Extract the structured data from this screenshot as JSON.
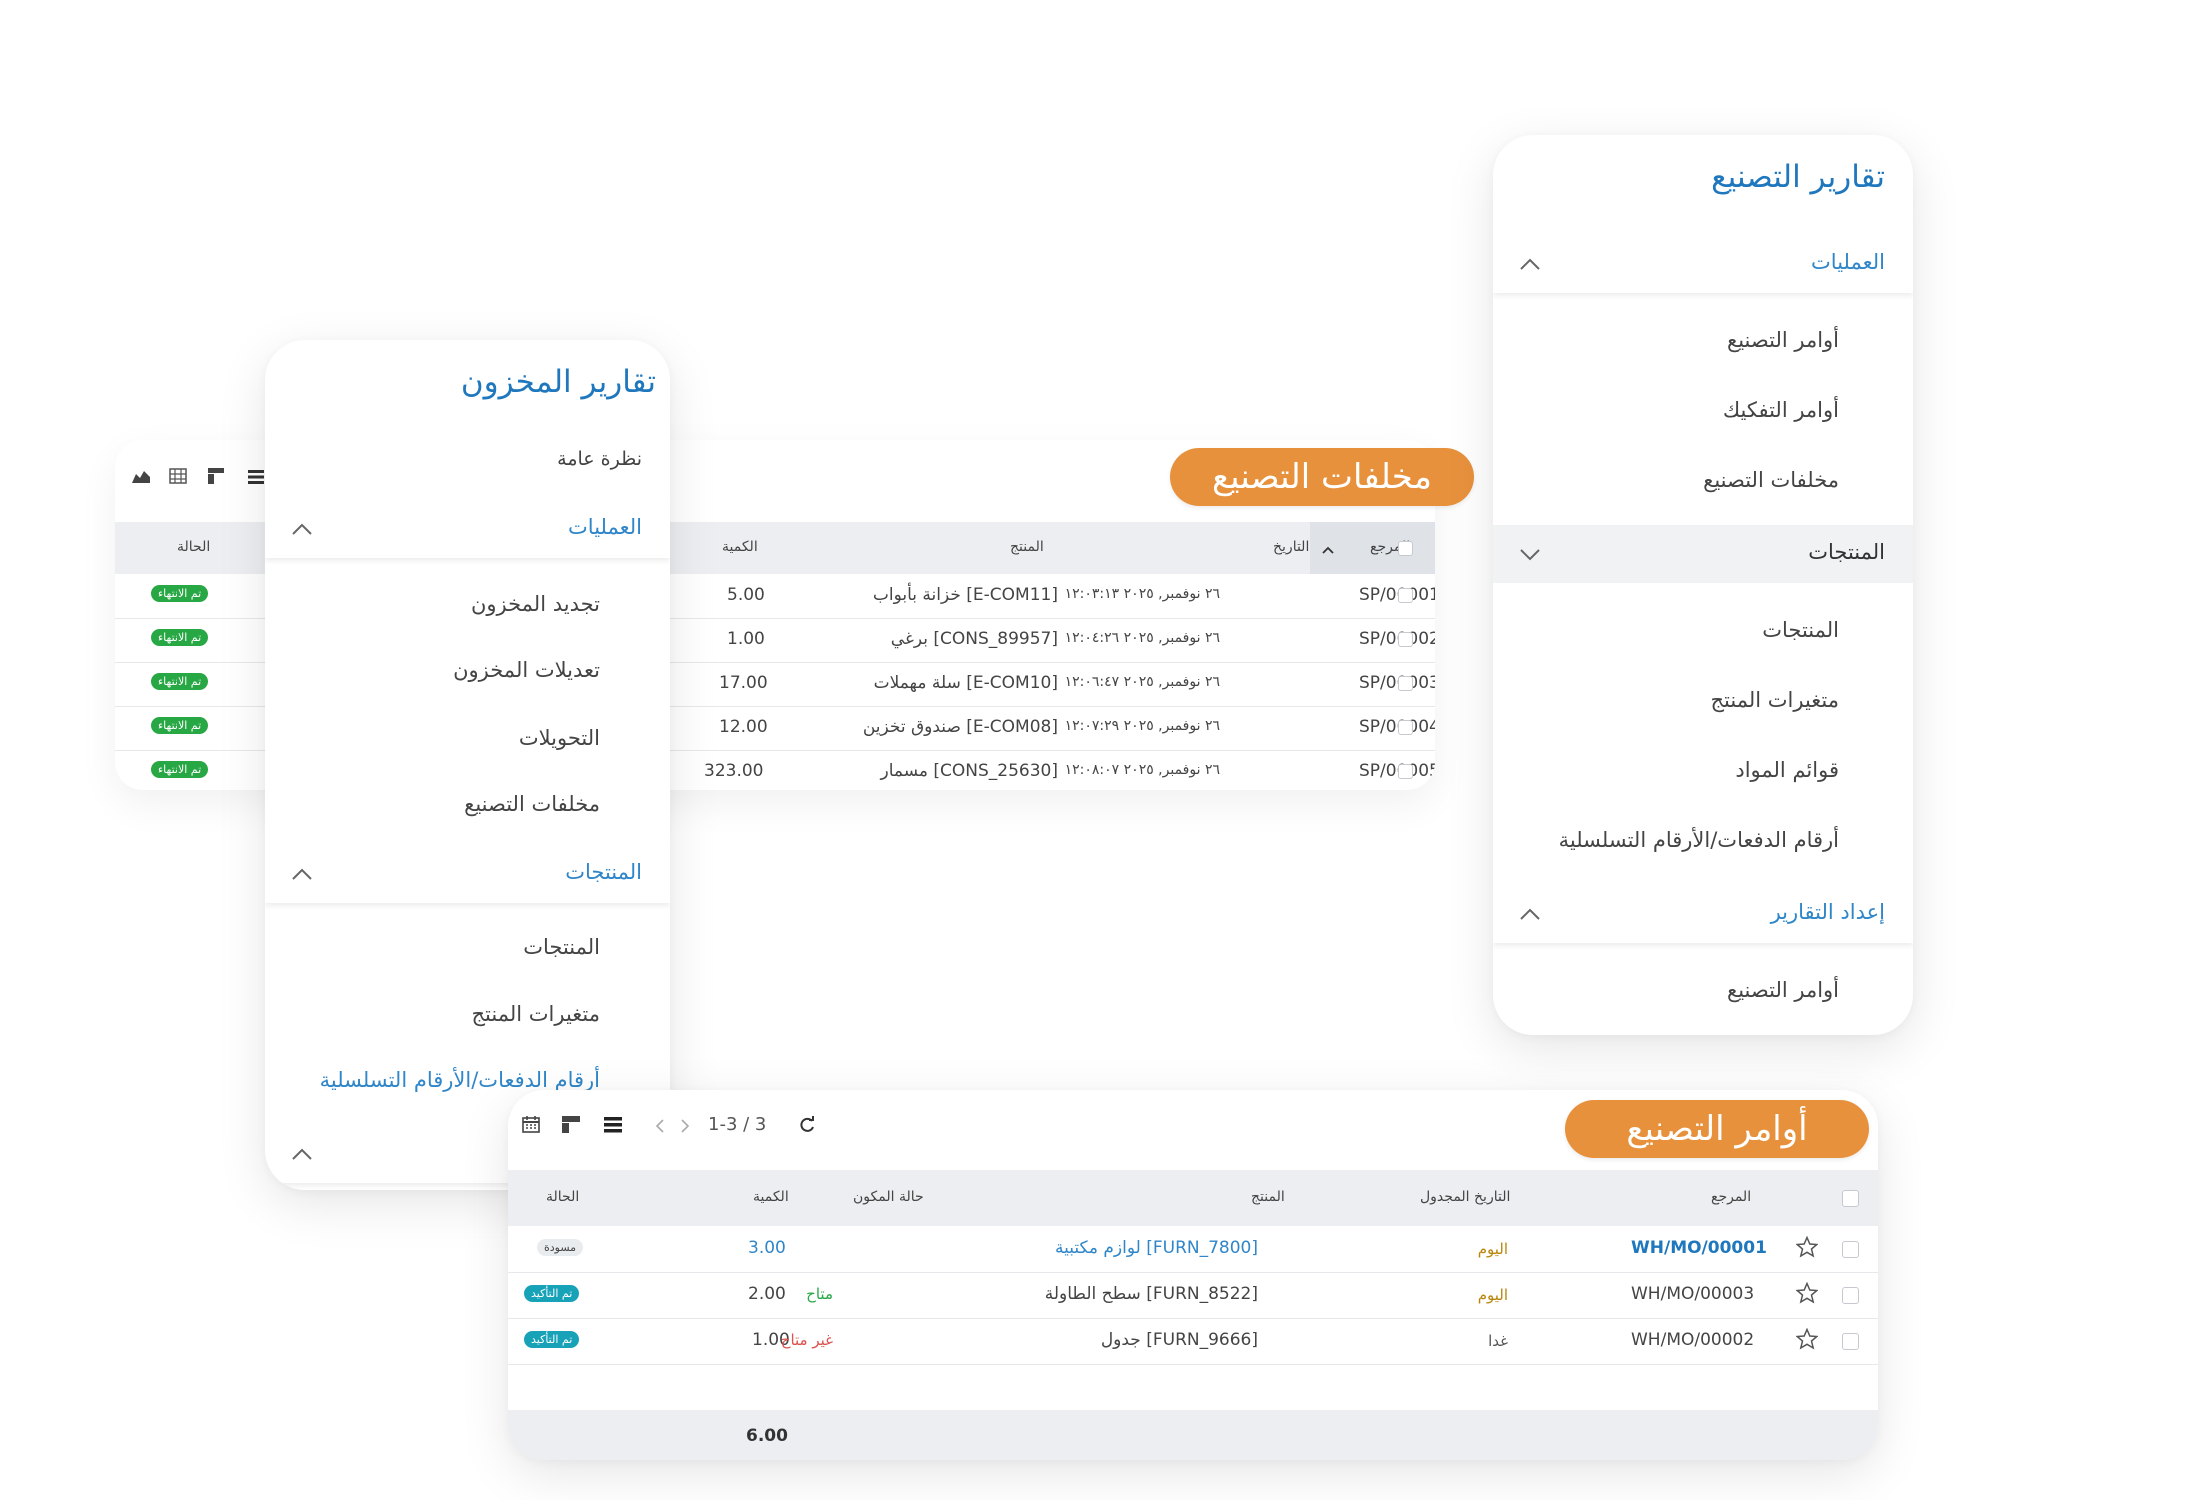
{
  "manufacturing_menu": {
    "title": "تقارير التصنيع",
    "sections": [
      {
        "label": "العمليات",
        "expanded": true,
        "items": [
          "أوامر التصنيع",
          "أوامر التفكيك",
          "مخلفات التصنيع"
        ]
      },
      {
        "label": "المنتجات",
        "expanded": false,
        "items": [
          "المنتجات",
          "متغيرات المنتج",
          "قوائم المواد",
          "أرقام الدفعات/الأرقام التسلسلية"
        ]
      },
      {
        "label": "إعداد التقارير",
        "expanded": true,
        "items": [
          "أوامر التصنيع"
        ]
      }
    ]
  },
  "inventory_menu": {
    "title": "تقارير المخزون",
    "overview": "نظرة عامة",
    "sections": [
      {
        "label": "العمليات",
        "items": [
          "تجديد المخزون",
          "تعديلات المخزون",
          "التحويلات",
          "مخلفات التصنيع"
        ]
      },
      {
        "label": "المنتجات",
        "items": [
          "المنتجات",
          "متغيرات المنتج",
          "أرقام الدفعات/الأرقام التسلسلية"
        ]
      }
    ]
  },
  "scrap": {
    "tag": "مخلفات التصنيع",
    "columns": {
      "status": "الحالة",
      "qty": "الكمية",
      "product": "المنتج",
      "date": "التاريخ",
      "ref": "المرجع"
    },
    "rows": [
      {
        "ref": "SP/00001",
        "date": "٢٦ نوفمبر, ٢٠٢٥ ١٢:٠٣:١٣",
        "product": "[E-COM11] خزانة بأبواب",
        "qty": "5.00",
        "status": "تم الانتهاء"
      },
      {
        "ref": "SP/00002",
        "date": "٢٦ نوفمبر, ٢٠٢٥ ١٢:٠٤:٢٦",
        "product": "[CONS_89957] برغي",
        "qty": "1.00",
        "status": "تم الانتهاء"
      },
      {
        "ref": "SP/00003",
        "date": "٢٦ نوفمبر, ٢٠٢٥ ١٢:٠٦:٤٧",
        "product": "[E-COM10] سلة مهملات",
        "qty": "17.00",
        "status": "تم الانتهاء"
      },
      {
        "ref": "SP/00004",
        "date": "٢٦ نوفمبر, ٢٠٢٥ ١٢:٠٧:٢٩",
        "product": "[E-COM08] صندوق تخزين",
        "qty": "12.00",
        "status": "تم الانتهاء"
      },
      {
        "ref": "SP/00005",
        "date": "٢٦ نوفمبر, ٢٠٢٥ ١٢:٠٨:٠٧",
        "product": "[CONS_25630] مسمار",
        "qty": "323.00",
        "status": "تم الانتهاء"
      }
    ]
  },
  "mo": {
    "tag": "أوامر التصنيع",
    "pager": "1-3 / 3",
    "columns": {
      "ref": "المرجع",
      "scheduled": "التاريخ المجدول",
      "product": "المنتج",
      "component": "حالة المكون",
      "qty": "الكمية",
      "status": "الحالة"
    },
    "rows": [
      {
        "ref": "WH/MO/00001",
        "scheduled": "اليوم",
        "product": "[FURN_7800] لوازم مكتبية",
        "component": "",
        "qty": "3.00",
        "status": "مسودة"
      },
      {
        "ref": "WH/MO/00003",
        "scheduled": "اليوم",
        "product": "[FURN_8522] سطح الطاولة",
        "component": "متاح",
        "qty": "2.00",
        "status": "تم التأكيد"
      },
      {
        "ref": "WH/MO/00002",
        "scheduled": "غدا",
        "product": "[FURN_9666] جدول",
        "component": "غير متاح",
        "qty": "1.00",
        "status": "تم التأكيد"
      }
    ],
    "total": "6.00"
  },
  "colors": {
    "accent_orange": "#e8913d",
    "link_blue": "#2f86c9",
    "teal": "#17a2b8",
    "green": "#28a745",
    "red": "#d9534f",
    "amber": "#b8860b"
  }
}
